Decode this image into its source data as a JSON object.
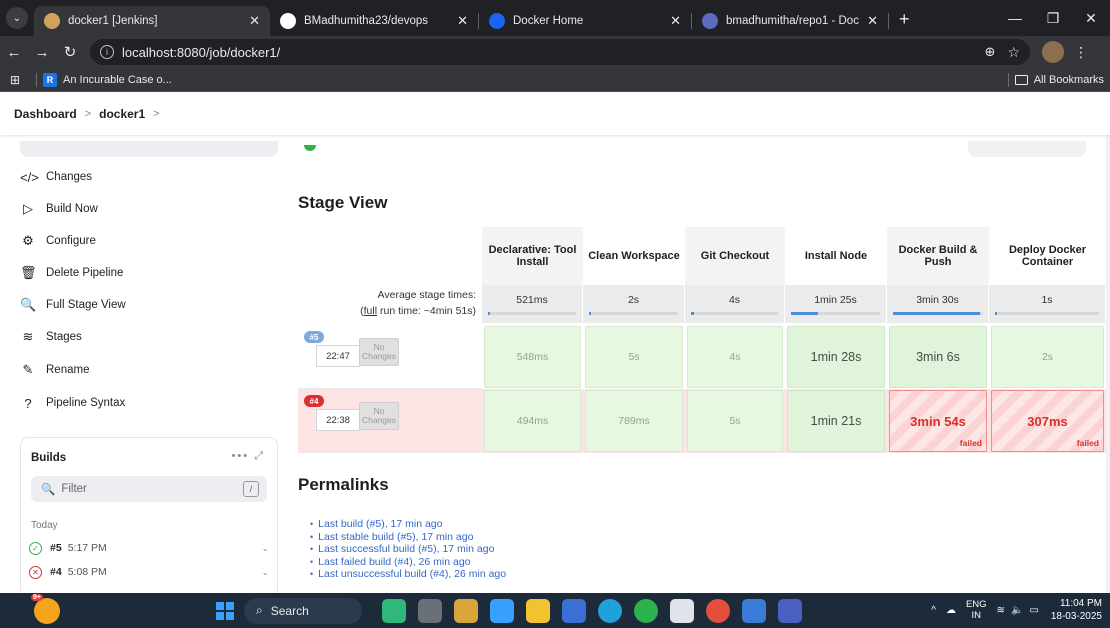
{
  "browser": {
    "tabs": [
      {
        "title": "docker1 [Jenkins]",
        "active": true,
        "color": "#d3a25a"
      },
      {
        "title": "BMadhumitha23/devops",
        "active": false,
        "color": "#ffffff"
      },
      {
        "title": "Docker Home",
        "active": false,
        "color": "#1d63ed"
      },
      {
        "title": "bmadhumitha/repo1 - Docker",
        "active": false,
        "color": "#5c6bc0"
      }
    ],
    "url": "localhost:8080/job/docker1/",
    "bookmark": "An Incurable Case o...",
    "bookmark_letter": "R",
    "all_bookmarks": "All Bookmarks"
  },
  "breadcrumb": [
    "Dashboard",
    "docker1"
  ],
  "sidebar": {
    "items": [
      {
        "icon": "</>",
        "label": "Changes"
      },
      {
        "icon": "▷",
        "label": "Build Now"
      },
      {
        "icon": "⚙",
        "label": "Configure"
      },
      {
        "icon": "🗑",
        "label": "Delete Pipeline"
      },
      {
        "icon": "🔍",
        "label": "Full Stage View"
      },
      {
        "icon": "≋",
        "label": "Stages"
      },
      {
        "icon": "✎",
        "label": "Rename"
      },
      {
        "icon": "?",
        "label": "Pipeline Syntax"
      }
    ]
  },
  "builds": {
    "title": "Builds",
    "filter_placeholder": "Filter",
    "filter_key": "/",
    "group": "Today",
    "rows": [
      {
        "num": "#5",
        "time": "5:17 PM",
        "status": "success"
      },
      {
        "num": "#4",
        "time": "5:08 PM",
        "status": "failed"
      }
    ]
  },
  "stage_view": {
    "title": "Stage View",
    "avg_label": "Average stage times:",
    "full_run_word": "full",
    "full_run_rest": " run time: ~4min 51s)",
    "stages": [
      {
        "name": "Declarative: Tool Install",
        "avg": "521ms",
        "avg_fraction": 0.02
      },
      {
        "name": "Clean Workspace",
        "avg": "2s",
        "avg_fraction": 0.02
      },
      {
        "name": "Git Checkout",
        "avg": "4s",
        "avg_fraction": 0.03
      },
      {
        "name": "Install Node",
        "avg": "1min 25s",
        "avg_fraction": 0.3
      },
      {
        "name": "Docker Build & Push",
        "avg": "3min 30s",
        "avg_fraction": 0.98
      },
      {
        "name": "Deploy Docker Container",
        "avg": "1s",
        "avg_fraction": 0.02
      }
    ],
    "runs": [
      {
        "badge": "#5",
        "time": "22:47",
        "changes": "No Changes",
        "status": "success",
        "values": [
          "548ms",
          "5s",
          "4s",
          "1min 28s",
          "3min 6s",
          "2s"
        ],
        "states": [
          "ok",
          "ok",
          "ok",
          "ok-dark",
          "ok-dark",
          "ok"
        ]
      },
      {
        "badge": "#4",
        "time": "22:38",
        "changes": "No Changes",
        "status": "failed",
        "values": [
          "494ms",
          "789ms",
          "5s",
          "1min 21s",
          "3min 54s",
          "307ms"
        ],
        "states": [
          "ok",
          "ok",
          "ok",
          "ok-dark",
          "fail",
          "fail"
        ]
      }
    ],
    "failed_label": "failed"
  },
  "permalinks": {
    "title": "Permalinks",
    "links": [
      "Last build (#5), 17 min ago",
      "Last stable build (#5), 17 min ago",
      "Last successful build (#5), 17 min ago",
      "Last failed build (#4), 26 min ago",
      "Last unsuccessful build (#4), 26 min ago"
    ]
  },
  "taskbar": {
    "weather_badge": "9+",
    "search": "Search",
    "lang_top": "ENG",
    "lang_bottom": "IN",
    "time": "11:04 PM",
    "date": "18-03-2025"
  }
}
